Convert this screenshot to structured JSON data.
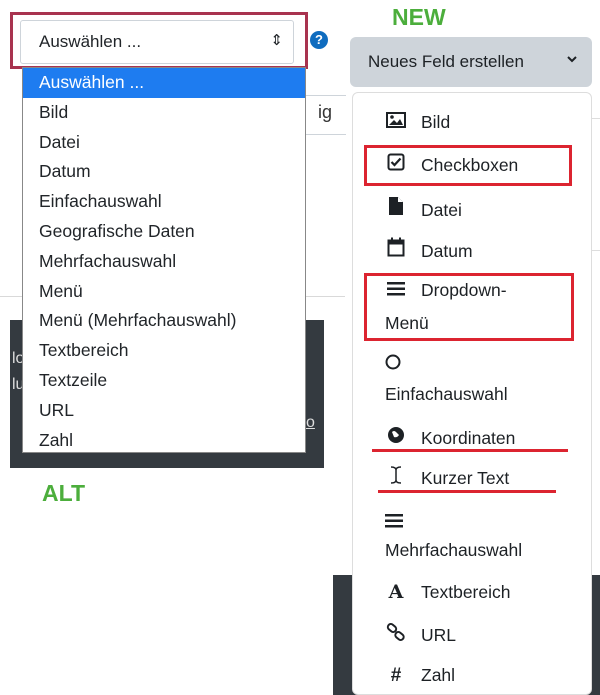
{
  "labels": {
    "new": "NEW",
    "alt": "ALT"
  },
  "old_select": {
    "value": "Auswählen ...",
    "caret": "⇕",
    "help": "?",
    "options": [
      "Auswählen ...",
      "Bild",
      "Datei",
      "Datum",
      "Einfachauswahl",
      "Geografische Daten",
      "Mehrfachauswahl",
      "Menü",
      "Menü (Mehrfachauswahl)",
      "Textbereich",
      "Textzeile",
      "URL",
      "Zahl"
    ],
    "selected_index": 0
  },
  "new_dropdown": {
    "button_label": "Neues Feld erstellen",
    "caret": "⌄",
    "items": {
      "bild": "Bild",
      "checkboxen": "Checkboxen",
      "datei": "Datei",
      "datum": "Datum",
      "dropdown_line1": "Dropdown-",
      "dropdown_line2": "Menü",
      "einfachauswahl": "Einfachauswahl",
      "koordinaten": "Koordinaten",
      "kurzer_text": "Kurzer Text",
      "mehrfachauswahl": "Mehrfachauswahl",
      "textbereich": "Textbereich",
      "url": "URL",
      "zahl": "Zahl"
    }
  },
  "background": {
    "input_fragment": "ig",
    "dark_text_1": "lo",
    "dark_text_2": "lu",
    "link_fragment": "o"
  },
  "colors": {
    "highlight_red": "#dc2430",
    "old_box_red": "#a8334f",
    "label_green": "#4cae3c",
    "selected_blue": "#1e7cf0"
  }
}
